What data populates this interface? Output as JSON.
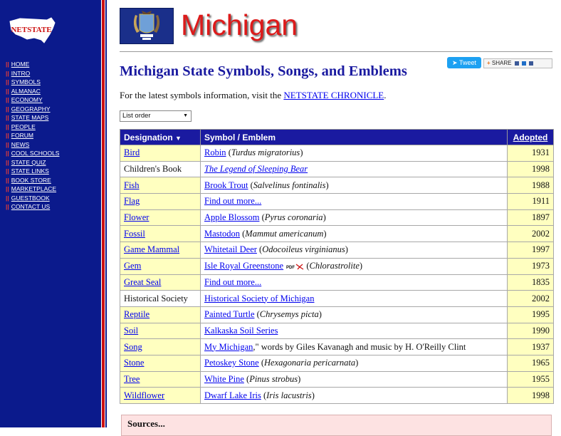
{
  "site": {
    "logo_text": "NETSTATE",
    "nav": [
      "HOME",
      "INTRO",
      "SYMBOLS",
      "ALMANAC",
      "ECONOMY",
      "GEOGRAPHY",
      "STATE MAPS",
      "PEOPLE",
      "FORUM",
      "NEWS",
      "COOL SCHOOLS",
      "STATE QUIZ",
      "STATE LINKS",
      "BOOK STORE",
      "MARKETPLACE",
      "GUESTBOOK",
      "CONTACT US"
    ],
    "nav_separator": "||"
  },
  "header": {
    "state_name": "Michigan",
    "tweet_label": "Tweet",
    "share_label": "SHARE"
  },
  "page": {
    "heading": "Michigan State Symbols, Songs, and Emblems",
    "intro_text": "For the latest symbols information, visit the ",
    "intro_link": "NETSTATE CHRONICLE",
    "intro_end": ".",
    "order_select": "List order"
  },
  "table": {
    "headers": {
      "designation": "Designation",
      "symbol": "Symbol / Emblem",
      "adopted": "Adopted"
    },
    "rows": [
      {
        "designation": "Bird",
        "link": "Robin",
        "pre": "",
        "post": " (",
        "latin": "Turdus migratorius",
        "tail": ")",
        "year": "1931"
      },
      {
        "designation": "Children's Book",
        "link": "The Legend of Sleeping Bear",
        "pre": "",
        "post": "",
        "latin": "",
        "tail": "",
        "year": "1998"
      },
      {
        "designation": "Fish",
        "link": "Brook Trout",
        "pre": "",
        "post": " (",
        "latin": "Salvelinus fontinalis",
        "tail": ")",
        "year": "1988"
      },
      {
        "designation": "Flag",
        "link": "Find out more...",
        "pre": "",
        "post": "",
        "latin": "",
        "tail": "",
        "year": "1911"
      },
      {
        "designation": "Flower",
        "link": "Apple Blossom",
        "pre": "",
        "post": " (",
        "latin": "Pyrus coronaria",
        "tail": ")",
        "year": "1897"
      },
      {
        "designation": "Fossil",
        "link": "Mastodon",
        "pre": "",
        "post": " (",
        "latin": "Mammut americanum",
        "tail": ")",
        "year": "2002"
      },
      {
        "designation": "Game Mammal",
        "link": "Whitetail Deer",
        "pre": "",
        "post": " (",
        "latin": "Odocoileus virginianus",
        "tail": ")",
        "year": "1997"
      },
      {
        "designation": "Gem",
        "link": "Isle Royal Greenstone",
        "pre": "",
        "post": " (",
        "latin": "Chlorastrolite",
        "tail": ")",
        "year": "1973"
      },
      {
        "designation": "Great Seal",
        "link": "Find out more...",
        "pre": "",
        "post": "",
        "latin": "",
        "tail": "",
        "year": "1835"
      },
      {
        "designation": "Historical Society",
        "link": "Historical Society of Michigan",
        "pre": "",
        "post": "",
        "latin": "",
        "tail": "",
        "year": "2002"
      },
      {
        "designation": "Reptile",
        "link": "Painted Turtle",
        "pre": "",
        "post": " (",
        "latin": "Chrysemys picta",
        "tail": ")",
        "year": "1995"
      },
      {
        "designation": "Soil",
        "link": "Kalkaska Soil Series",
        "pre": "",
        "post": "",
        "latin": "",
        "tail": "",
        "year": "1990"
      },
      {
        "designation": "Song",
        "link": "My Michigan",
        "pre": "",
        "post": ",\" words by Giles Kavanagh and music by H. O'Reilly Clint",
        "latin": "",
        "tail": "",
        "year": "1937"
      },
      {
        "designation": "Stone",
        "link": "Petoskey Stone",
        "pre": "",
        "post": " (",
        "latin": "Hexagonaria pericarnata",
        "tail": ")",
        "year": "1965"
      },
      {
        "designation": "Tree",
        "link": "White Pine",
        "pre": "",
        "post": " (",
        "latin": "Pinus strobus",
        "tail": ")",
        "year": "1955"
      },
      {
        "designation": "Wildflower",
        "link": "Dwarf Lake Iris",
        "pre": "",
        "post": " (",
        "latin": "Iris lacustris",
        "tail": ")",
        "year": "1998"
      }
    ]
  },
  "sources": {
    "label": "Sources..."
  },
  "colors": {
    "sidebar": "#0b1a8c",
    "title_red": "#dd1a1a",
    "heading_blue": "#1a1aa0",
    "cell_yellow": "#ffffc0",
    "sources_pink": "#fde2e2"
  }
}
